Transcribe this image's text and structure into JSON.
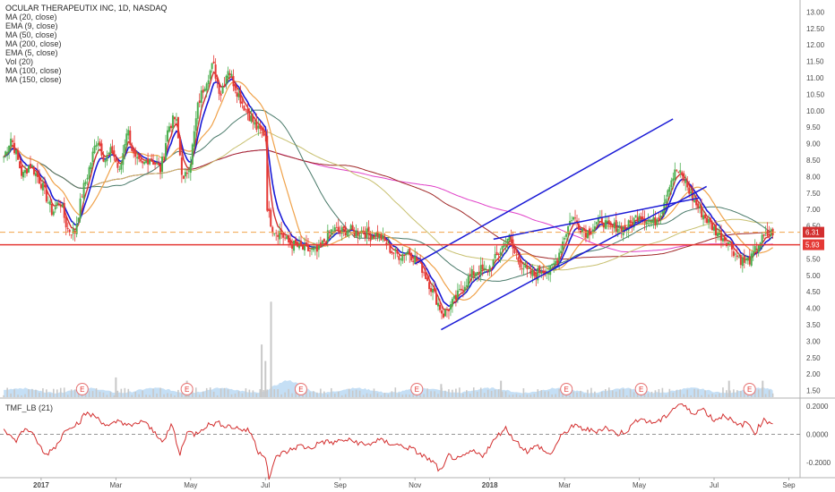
{
  "chart_data": {
    "type": "candlestick",
    "title": "OCULAR THERAPEUTIX INC, 1D, NASDAQ",
    "indicators": [
      "MA (20, close)",
      "EMA (9, close)",
      "MA (50, close)",
      "MA (200, close)",
      "EMA (5, close)",
      "Vol (20)",
      "MA (100, close)",
      "MA (150, close)"
    ],
    "lower_indicator": "TMF_LB (21)",
    "ylim": [
      1.3,
      13.2
    ],
    "y_ticks": [
      "13.00",
      "12.50",
      "12.00",
      "11.50",
      "11.00",
      "10.50",
      "10.00",
      "9.50",
      "9.00",
      "8.50",
      "8.00",
      "7.50",
      "7.00",
      "6.50",
      "6.00",
      "5.50",
      "5.00",
      "4.50",
      "4.00",
      "3.50",
      "3.00",
      "2.50",
      "2.00",
      "1.50"
    ],
    "tmf_ticks": [
      "0.2000",
      "0.0000",
      "-0.2000"
    ],
    "tmf_ylim": [
      -0.3,
      0.25
    ],
    "x_labels": [
      {
        "label": "2017",
        "bold": true
      },
      {
        "label": "Mar"
      },
      {
        "label": "May"
      },
      {
        "label": "Jul"
      },
      {
        "label": "Sep"
      },
      {
        "label": "Nov"
      },
      {
        "label": "2018",
        "bold": true
      },
      {
        "label": "Mar"
      },
      {
        "label": "May"
      },
      {
        "label": "Jul"
      },
      {
        "label": "Sep"
      }
    ],
    "x_range_months": [
      -1.1,
      20.3
    ],
    "x_label_months": [
      0,
      2,
      4,
      6,
      8,
      10,
      12,
      14,
      16,
      18,
      20
    ],
    "price_anchors": [
      [
        -1.0,
        8.6
      ],
      [
        -0.8,
        9.2
      ],
      [
        -0.5,
        8.0
      ],
      [
        -0.3,
        8.4
      ],
      [
        0,
        7.8
      ],
      [
        0.3,
        6.9
      ],
      [
        0.5,
        7.3
      ],
      [
        0.7,
        6.4
      ],
      [
        0.9,
        6.3
      ],
      [
        1.1,
        7.5
      ],
      [
        1.3,
        8.3
      ],
      [
        1.5,
        9.2
      ],
      [
        1.7,
        8.5
      ],
      [
        1.9,
        8.8
      ],
      [
        2.1,
        8.1
      ],
      [
        2.3,
        9.5
      ],
      [
        2.5,
        8.5
      ],
      [
        2.7,
        8.3
      ],
      [
        2.9,
        8.6
      ],
      [
        3.2,
        8.2
      ],
      [
        3.4,
        9.5
      ],
      [
        3.6,
        9.8
      ],
      [
        3.8,
        7.8
      ],
      [
        4.0,
        8.5
      ],
      [
        4.2,
        10.2
      ],
      [
        4.4,
        10.9
      ],
      [
        4.6,
        11.4
      ],
      [
        4.8,
        10.5
      ],
      [
        5.0,
        11.3
      ],
      [
        5.2,
        10.7
      ],
      [
        5.4,
        10.2
      ],
      [
        5.6,
        9.8
      ],
      [
        5.8,
        9.4
      ],
      [
        6.0,
        9.3
      ],
      [
        6.05,
        7.0
      ],
      [
        6.2,
        6.4
      ],
      [
        6.4,
        6.3
      ],
      [
        6.6,
        6.0
      ],
      [
        6.8,
        5.9
      ],
      [
        7.0,
        5.8
      ],
      [
        7.2,
        5.75
      ],
      [
        7.4,
        5.7
      ],
      [
        7.6,
        6.1
      ],
      [
        7.8,
        6.4
      ],
      [
        8.0,
        6.3
      ],
      [
        8.2,
        6.4
      ],
      [
        8.4,
        6.3
      ],
      [
        8.6,
        6.35
      ],
      [
        8.8,
        6.2
      ],
      [
        9.0,
        6.25
      ],
      [
        9.2,
        6.0
      ],
      [
        9.4,
        5.7
      ],
      [
        9.6,
        5.6
      ],
      [
        9.8,
        5.75
      ],
      [
        10.0,
        5.5
      ],
      [
        10.2,
        5.2
      ],
      [
        10.4,
        4.7
      ],
      [
        10.6,
        4.2
      ],
      [
        10.75,
        3.8
      ],
      [
        10.9,
        4.0
      ],
      [
        11.1,
        4.3
      ],
      [
        11.3,
        4.7
      ],
      [
        11.5,
        5.0
      ],
      [
        11.7,
        5.2
      ],
      [
        11.9,
        5.1
      ],
      [
        12.1,
        5.4
      ],
      [
        12.3,
        5.8
      ],
      [
        12.5,
        6.2
      ],
      [
        12.65,
        5.7
      ],
      [
        12.8,
        5.4
      ],
      [
        13.0,
        5.1
      ],
      [
        13.2,
        5.0
      ],
      [
        13.4,
        5.2
      ],
      [
        13.6,
        5.1
      ],
      [
        13.8,
        5.5
      ],
      [
        14.0,
        6.2
      ],
      [
        14.2,
        6.8
      ],
      [
        14.4,
        6.5
      ],
      [
        14.6,
        6.3
      ],
      [
        14.8,
        6.5
      ],
      [
        15.0,
        6.7
      ],
      [
        15.2,
        6.4
      ],
      [
        15.4,
        6.5
      ],
      [
        15.6,
        6.4
      ],
      [
        15.8,
        6.6
      ],
      [
        16.0,
        6.9
      ],
      [
        16.2,
        6.7
      ],
      [
        16.4,
        6.6
      ],
      [
        16.6,
        7.0
      ],
      [
        16.8,
        7.8
      ],
      [
        17.0,
        8.2
      ],
      [
        17.2,
        7.9
      ],
      [
        17.4,
        7.4
      ],
      [
        17.6,
        7.0
      ],
      [
        17.8,
        6.7
      ],
      [
        18.0,
        6.4
      ],
      [
        18.2,
        6.2
      ],
      [
        18.4,
        6.0
      ],
      [
        18.6,
        5.6
      ],
      [
        18.8,
        5.4
      ],
      [
        19.0,
        5.5
      ],
      [
        19.2,
        6.0
      ],
      [
        19.4,
        6.2
      ],
      [
        19.6,
        6.35
      ]
    ],
    "ma_fast_color": "#d32f2f",
    "ema_color": "#1a1ad6",
    "ma50_color": "#4a7a6a",
    "ma100_color": "#f0a24a",
    "ma150_color": "#a02828",
    "ma200_color": "#e040c8",
    "ma_olive_color": "#c8c070",
    "candle_up": "#4caf50",
    "candle_down": "#e53935",
    "channel_color": "#1a1ad6",
    "channel_lines": [
      [
        [
          10.0,
          5.35
        ],
        [
          16.9,
          9.75
        ]
      ],
      [
        [
          10.7,
          3.35
        ],
        [
          17.8,
          7.7
        ]
      ],
      [
        [
          12.1,
          6.1
        ],
        [
          17.6,
          7.35
        ]
      ]
    ],
    "support_line": {
      "value": 5.93,
      "label": "5.93",
      "color": "#e53935"
    },
    "current_line": {
      "value": 6.31,
      "label": "6.31",
      "color": "#f0a24a"
    },
    "earnings": [
      {
        "label": "E",
        "month": 1.1
      },
      {
        "label": "E",
        "month": 3.9
      },
      {
        "label": "E",
        "month": 6.95
      },
      {
        "label": "E",
        "month": 10.05
      },
      {
        "label": "E",
        "month": 14.05
      },
      {
        "label": "E",
        "month": 16.05
      },
      {
        "label": "E",
        "month": 18.95
      }
    ],
    "volume_spikes": [
      {
        "month": 6.15,
        "h": 2.9
      },
      {
        "month": 5.9,
        "h": 1.6
      },
      {
        "month": 6.0,
        "h": 1.1
      },
      {
        "month": 2.0,
        "h": 0.6
      },
      {
        "month": 3.9,
        "h": 0.5
      },
      {
        "month": 10.7,
        "h": 0.4
      },
      {
        "month": 12.3,
        "h": 0.5
      },
      {
        "month": 18.4,
        "h": 0.5
      },
      {
        "month": 19.3,
        "h": 0.5
      }
    ],
    "tmf_anchors": [
      [
        -1.0,
        0.05
      ],
      [
        -0.7,
        -0.05
      ],
      [
        -0.4,
        0.05
      ],
      [
        -0.1,
        -0.05
      ],
      [
        0.1,
        -0.15
      ],
      [
        0.4,
        -0.08
      ],
      [
        0.7,
        0.05
      ],
      [
        1.0,
        0.08
      ],
      [
        1.2,
        0.15
      ],
      [
        1.5,
        0.12
      ],
      [
        1.8,
        0.05
      ],
      [
        2.1,
        0.1
      ],
      [
        2.4,
        0.05
      ],
      [
        2.7,
        0.1
      ],
      [
        3.0,
        0.02
      ],
      [
        3.3,
        -0.05
      ],
      [
        3.5,
        0.08
      ],
      [
        3.7,
        -0.15
      ],
      [
        3.9,
        0.02
      ],
      [
        4.1,
        0.0
      ],
      [
        4.4,
        0.06
      ],
      [
        4.7,
        0.08
      ],
      [
        5.0,
        0.06
      ],
      [
        5.3,
        0.04
      ],
      [
        5.6,
        0.02
      ],
      [
        5.8,
        -0.12
      ],
      [
        6.0,
        -0.15
      ],
      [
        6.1,
        -0.32
      ],
      [
        6.3,
        -0.15
      ],
      [
        6.6,
        -0.12
      ],
      [
        6.9,
        -0.08
      ],
      [
        7.2,
        -0.1
      ],
      [
        7.5,
        -0.05
      ],
      [
        7.8,
        -0.06
      ],
      [
        8.1,
        -0.04
      ],
      [
        8.4,
        -0.05
      ],
      [
        8.7,
        -0.08
      ],
      [
        9.0,
        -0.04
      ],
      [
        9.3,
        -0.06
      ],
      [
        9.6,
        -0.08
      ],
      [
        9.9,
        -0.1
      ],
      [
        10.2,
        -0.15
      ],
      [
        10.5,
        -0.2
      ],
      [
        10.7,
        -0.27
      ],
      [
        10.9,
        -0.15
      ],
      [
        11.2,
        -0.18
      ],
      [
        11.5,
        -0.12
      ],
      [
        11.8,
        -0.15
      ],
      [
        12.1,
        -0.05
      ],
      [
        12.4,
        0.05
      ],
      [
        12.7,
        -0.05
      ],
      [
        13.0,
        -0.12
      ],
      [
        13.3,
        -0.08
      ],
      [
        13.6,
        -0.15
      ],
      [
        13.9,
        -0.02
      ],
      [
        14.2,
        0.06
      ],
      [
        14.5,
        0.04
      ],
      [
        14.8,
        0.02
      ],
      [
        15.1,
        0.05
      ],
      [
        15.4,
        0.0
      ],
      [
        15.7,
        0.03
      ],
      [
        16.0,
        0.12
      ],
      [
        16.3,
        0.08
      ],
      [
        16.6,
        0.1
      ],
      [
        16.9,
        0.18
      ],
      [
        17.1,
        0.22
      ],
      [
        17.4,
        0.15
      ],
      [
        17.7,
        0.18
      ],
      [
        18.0,
        0.1
      ],
      [
        18.3,
        0.14
      ],
      [
        18.6,
        0.06
      ],
      [
        18.9,
        0.08
      ],
      [
        19.1,
        0.01
      ],
      [
        19.3,
        0.1
      ],
      [
        19.6,
        0.08
      ]
    ]
  }
}
